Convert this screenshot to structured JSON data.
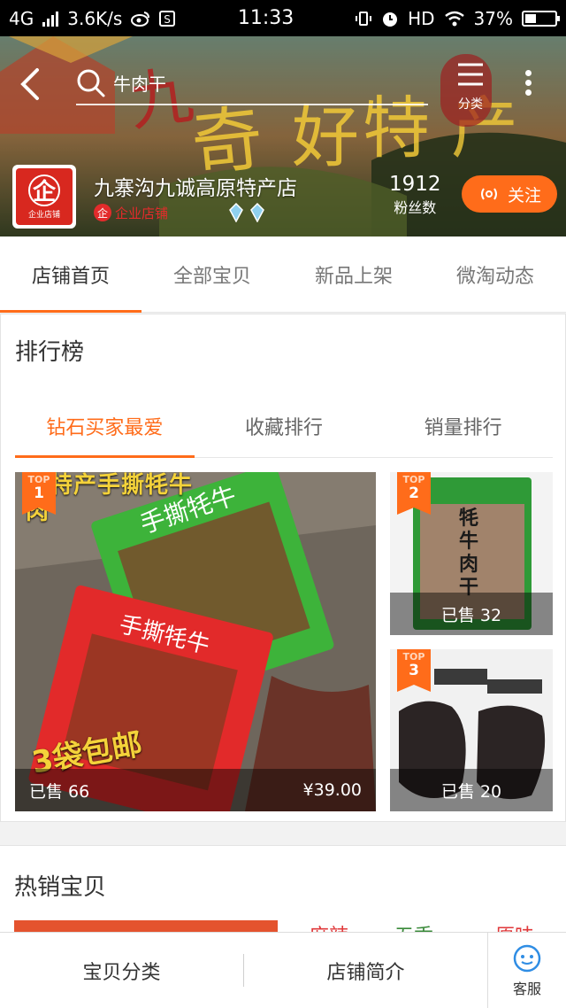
{
  "status_bar": {
    "network": "4G",
    "speed": "3.6K/s",
    "time": "11:33",
    "hd": "HD",
    "battery": "37%",
    "battery_level": 0.37
  },
  "header": {
    "search_text": "牛肉干",
    "category_label": "分类"
  },
  "shop": {
    "name": "九寨沟九诚高原特产店",
    "logo_text": "企",
    "logo_sub": "企业店铺",
    "enterprise_badge": "企业店铺",
    "fans_count": "1912",
    "fans_label": "粉丝数",
    "follow_label": "关注"
  },
  "shop_tabs": [
    "店铺首页",
    "全部宝贝",
    "新品上架",
    "微淘动态"
  ],
  "ranking": {
    "title": "排行榜",
    "tabs": [
      "钻石买家最爱",
      "收藏排行",
      "销量排行"
    ],
    "top_label": "TOP",
    "items": [
      {
        "rank": "1",
        "sold": "已售 66",
        "price": "¥39.00",
        "banner_text": "原特产手撕牦牛肉",
        "promo_text": "3袋包邮"
      },
      {
        "rank": "2",
        "sold": "已售 32",
        "pack_text": "牦牛肉干"
      },
      {
        "rank": "3",
        "sold": "已售 20"
      }
    ]
  },
  "hot": {
    "title": "热销宝贝",
    "tags": [
      {
        "text": "麻辣",
        "color": "#e0393b"
      },
      {
        "text": "五香",
        "color": "#3a8a3a"
      },
      {
        "text": "原味",
        "color": "#e0393b"
      }
    ]
  },
  "bottom_bar": {
    "category": "宝贝分类",
    "intro": "店铺简介",
    "service": "客服"
  },
  "colors": {
    "accent": "#ff6c1a"
  }
}
